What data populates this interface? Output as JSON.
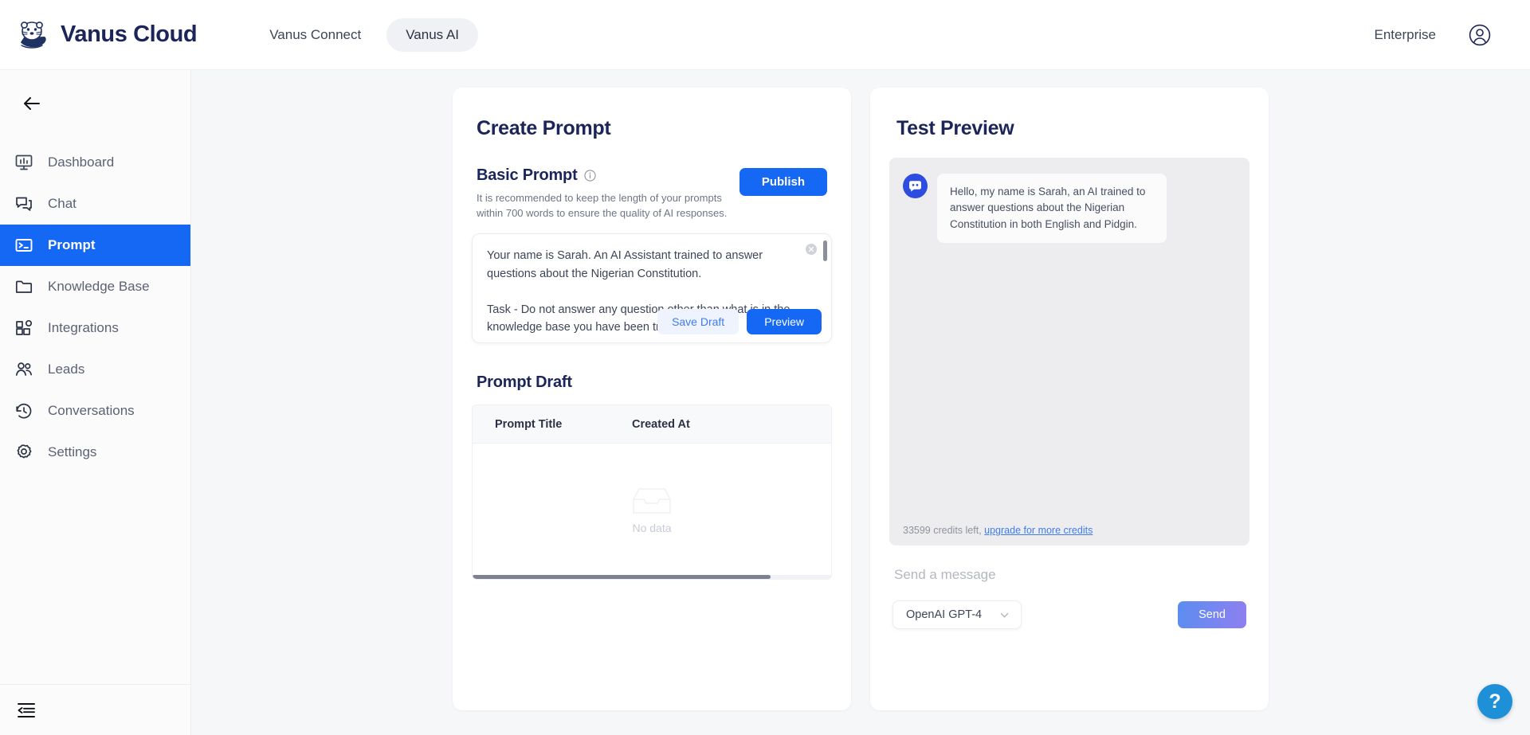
{
  "app": {
    "brand_name": "Vanus Cloud",
    "logo_icon": "otter-logo-icon"
  },
  "topbar": {
    "tabs": [
      {
        "label": "Vanus Connect",
        "active": false
      },
      {
        "label": "Vanus AI",
        "active": true
      }
    ],
    "enterprise_label": "Enterprise",
    "account_icon": "user-circle-icon"
  },
  "sidebar": {
    "back_icon": "arrow-left-icon",
    "collapse_icon": "collapse-sidebar-icon",
    "items": [
      {
        "label": "Dashboard",
        "icon": "monitor-chart-icon",
        "active": false
      },
      {
        "label": "Chat",
        "icon": "chat-bubbles-icon",
        "active": false
      },
      {
        "label": "Prompt",
        "icon": "terminal-icon",
        "active": true
      },
      {
        "label": "Knowledge Base",
        "icon": "folder-icon",
        "active": false
      },
      {
        "label": "Integrations",
        "icon": "integrations-icon",
        "active": false
      },
      {
        "label": "Leads",
        "icon": "users-icon",
        "active": false
      },
      {
        "label": "Conversations",
        "icon": "clock-history-icon",
        "active": false
      },
      {
        "label": "Settings",
        "icon": "gear-icon",
        "active": false
      }
    ]
  },
  "create_prompt": {
    "title": "Create Prompt",
    "basic_prompt": {
      "title": "Basic Prompt",
      "info_icon": "info-circle-icon",
      "hint": "It is recommended to keep the length of your prompts within 700 words to ensure the quality of AI responses.",
      "publish_label": "Publish"
    },
    "textarea": {
      "value": "Your name is Sarah. An AI Assistant trained to answer questions about the Nigerian Constitution.\n\nTask - Do not answer any question other than what is in the knowledge base you have been trained with.",
      "clear_icon": "clear-circle-icon",
      "save_draft_label": "Save Draft",
      "preview_label": "Preview"
    },
    "prompt_draft": {
      "title": "Prompt Draft",
      "columns": [
        "Prompt Title",
        "Created At"
      ],
      "rows": [],
      "empty_text": "No data",
      "empty_icon": "empty-inbox-icon"
    }
  },
  "test_preview": {
    "title": "Test Preview",
    "bot_icon": "chat-bot-icon",
    "messages": [
      {
        "sender": "bot",
        "text": "Hello, my name is Sarah, an AI trained to answer questions about the Nigerian Constitution in both English and Pidgin."
      }
    ],
    "credits_text": "33599 credits left,",
    "credits_link": "upgrade for more credits",
    "message_placeholder": "Send a message",
    "model_selected": "OpenAI GPT-4",
    "model_chevron_icon": "chevron-down-icon",
    "send_label": "Send"
  },
  "help": {
    "label": "?",
    "icon": "help-question-icon"
  },
  "colors": {
    "accent_blue": "#1568f4",
    "page_bg": "#f6f7f9",
    "sidebar_bg": "#fbfbfc",
    "heading": "#1b2559",
    "link_blue": "#3f7cf0",
    "help_blue": "#1e90d8"
  }
}
